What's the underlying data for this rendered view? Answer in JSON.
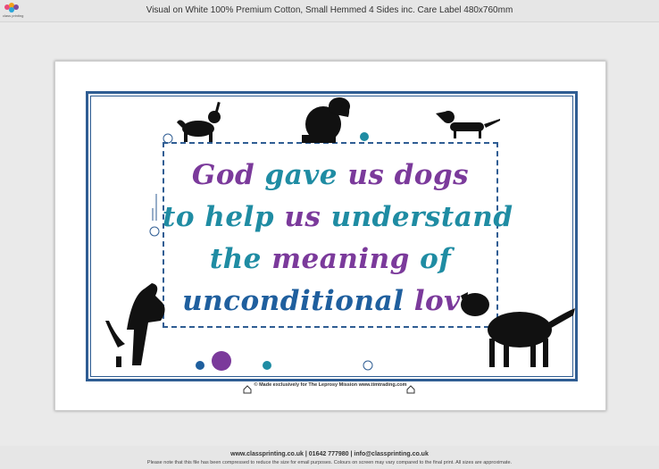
{
  "header": {
    "title": "Visual on White 100% Premium Cotton, Small Hemmed 4 Sides inc. Care Label 480x760mm",
    "brand": "class printing"
  },
  "artwork": {
    "quote_lines": [
      [
        "God",
        "gave",
        "us",
        "dogs"
      ],
      [
        "to",
        "help",
        "us",
        "understand"
      ],
      [
        "the",
        "meaning",
        "of"
      ],
      [
        "unconditional",
        "love"
      ]
    ],
    "credit": "© Made exclusively for The Leprosy Mission www.timtrading.com",
    "colors": {
      "frame": "#2f5d93",
      "purple": "#7b3a9b",
      "teal": "#1f8ca3",
      "blue": "#1f5f9e"
    }
  },
  "footer": {
    "contact": "www.classprinting.co.uk  |  01642 777980  |  info@classprinting.co.uk",
    "disclaimer": "Please note that this file has been compressed to reduce the size for email purposes.  Colours on screen may vary compared to the final print. All sizes are approximate."
  }
}
